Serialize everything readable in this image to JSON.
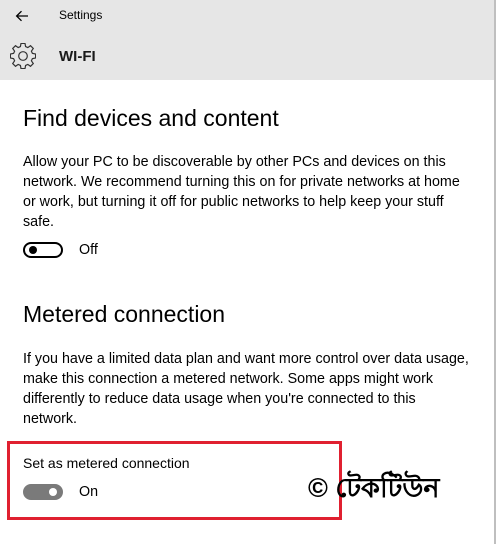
{
  "titlebar": {
    "title": "Settings",
    "back_icon": "back-arrow-icon"
  },
  "header": {
    "title": "WI-FI",
    "icon": "gear-icon"
  },
  "find_devices": {
    "title": "Find devices and content",
    "description": "Allow your PC to be discoverable by other PCs and devices on this network. We recommend turning this on for private networks at home or work, but turning it off for public networks to help keep your stuff safe.",
    "toggle_state": "Off",
    "toggle_on": false
  },
  "metered": {
    "title": "Metered connection",
    "description": "If you have a limited data plan and want more control over data usage, make this connection a metered network. Some apps might work differently to reduce data usage when you're connected to this network.",
    "setting_label": "Set as metered connection",
    "toggle_state": "On",
    "toggle_on": true
  },
  "watermark": "© টেকটিউন",
  "colors": {
    "highlight": "#e02030",
    "header_bg": "#e6e6e6",
    "toggle_on": "#7a7a7a"
  }
}
